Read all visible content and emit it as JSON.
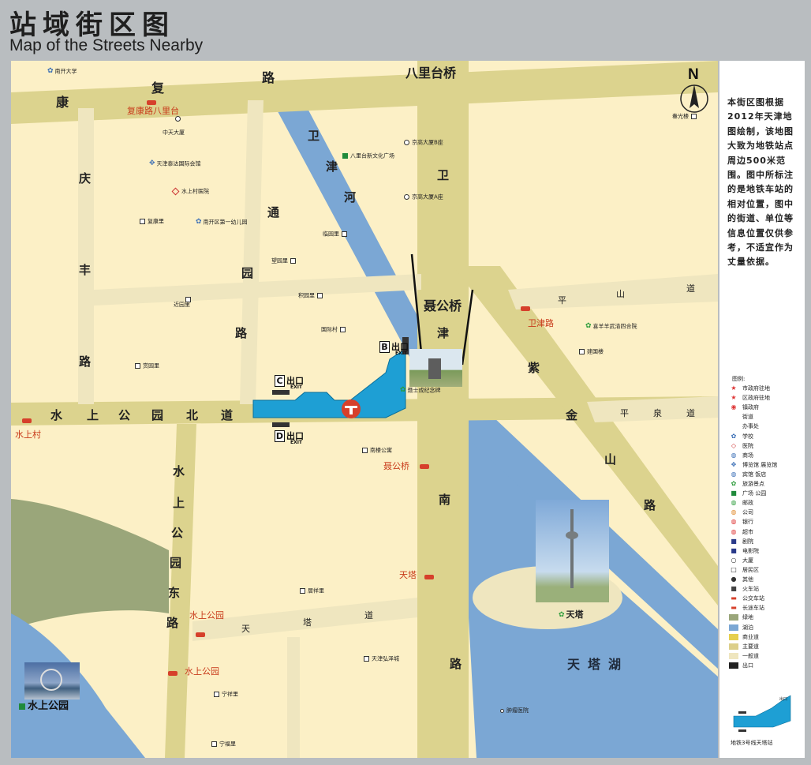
{
  "header": {
    "title_cn": "站域街区图",
    "title_en": "Map of the Streets Nearby"
  },
  "compass": {
    "letter": "N"
  },
  "roads": {
    "fukang_fu": "复",
    "fukang_kang": "康",
    "fukang_lu": "路",
    "balitai_bridge": "八里台桥",
    "qingfeng_qing": "庆",
    "qingfeng_feng": "丰",
    "qingfeng_lu": "路",
    "tongyuan_tong": "通",
    "tongyuan_yuan": "园",
    "tongyuan_lu": "路",
    "weijin_wei": "卫",
    "weijin_jin": "津",
    "niegong_bridge": "聂公桥",
    "shuishang_north": [
      "水",
      "上",
      "公",
      "园",
      "北",
      "道"
    ],
    "shuishang_east": [
      "水",
      "上",
      "公",
      "园",
      "东",
      "路"
    ],
    "weijin_south": [
      "南",
      "路"
    ],
    "pingshan": [
      "平",
      "山",
      "道"
    ],
    "pingquan": [
      "平",
      "泉",
      "道"
    ],
    "zijinshan": [
      "紫",
      "金",
      "山",
      "路"
    ],
    "tianta_dao": [
      "天",
      "塔",
      "道"
    ]
  },
  "water": {
    "weijin_river": [
      "卫",
      "津",
      "河"
    ],
    "tianta_lake": "天塔湖"
  },
  "stops": {
    "fukang_balitai": "复康路八里台",
    "shuishangcun": "水上村",
    "weijinlu": "卫津路",
    "niegongqiao": "聂公桥",
    "tianta": "天塔",
    "shuishang_park_1": "水上公园",
    "shuishang_park_2": "水上公园"
  },
  "pois": {
    "nankai_univ": "南开大学",
    "zhongtian": "中天大厦",
    "taida_hotel": "天津泰达国际会馆",
    "shuishangcun_hospital": "水上村医院",
    "fukang_li": "复康里",
    "kindergarten": "南开区第一幼儿园",
    "balitai_plaza": "八里台新文化广场",
    "jinggao_b": "京高大厦B座",
    "jinggao_a": "京高大厦A座",
    "linyuan": "临园里",
    "wangyuan": "望园里",
    "jinyuan": "近园里",
    "jiyuan": "积园里",
    "guoji": "国际村",
    "shangyuan": "赏园里",
    "chunguang": "春光楼",
    "xiyangyang": "喜羊羊武清四合院",
    "jianguo": "建国楼",
    "nielou": "南楼公寓",
    "niejie_memorial": "聂士成纪念碑",
    "juxiang": "居祥里",
    "hongze": "天津弘泽城",
    "ningxiang": "宁祥里",
    "ningfu": "宁福里",
    "tumor_hospital": "肿瘤医院",
    "tianta_landmark": "天塔",
    "shuishang_park_label": "水上公园"
  },
  "exits": {
    "b": {
      "letter": "B",
      "text": "出口",
      "sub": "EXIT"
    },
    "c": {
      "letter": "C",
      "text": "出口",
      "sub": "EXIT"
    },
    "d": {
      "letter": "D",
      "text": "出口",
      "sub": "EXIT"
    }
  },
  "sidebar": {
    "note": "本街区图根据2012年天津地图绘制，该地图大致为地铁站点周边500米范围。图中所标注的是地铁车站的相对位置，图中的街道、单位等信息位置仅供参考，不适宜作为丈量依据。",
    "legend_title": "图例:",
    "legend": [
      {
        "label": "市政府驻地",
        "sym": "★",
        "color": "#d33"
      },
      {
        "label": "区政府驻地",
        "sym": "★",
        "color": "#d33"
      },
      {
        "label": "镇政府",
        "sym": "◉",
        "color": "#d33"
      },
      {
        "label": "街道",
        "sym": "",
        "color": ""
      },
      {
        "label": "办事处",
        "sym": "",
        "color": ""
      },
      {
        "label": "学校",
        "sym": "✿",
        "color": "#3b6fb6"
      },
      {
        "label": "医院",
        "sym": "◇",
        "color": "#c33"
      },
      {
        "label": "商场",
        "sym": "◍",
        "color": "#3b6fb6"
      },
      {
        "label": "博览馆 展览馆",
        "sym": "✥",
        "color": "#3b6fb6"
      },
      {
        "label": "宾馆 饭店",
        "sym": "◍",
        "color": "#3b6fb6"
      },
      {
        "label": "旅游景点",
        "sym": "✿",
        "color": "#2b9b3a"
      },
      {
        "label": "广场 公园",
        "sym": "■",
        "color": "#1f8a3b"
      },
      {
        "label": "邮政",
        "sym": "◍",
        "color": "#2b9b3a"
      },
      {
        "label": "公司",
        "sym": "◍",
        "color": "#e08a2b"
      },
      {
        "label": "银行",
        "sym": "◍",
        "color": "#d33"
      },
      {
        "label": "超市",
        "sym": "◍",
        "color": "#d33"
      },
      {
        "label": "剧院",
        "sym": "■",
        "color": "#2a3a8a"
      },
      {
        "label": "电影院",
        "sym": "■",
        "color": "#2a3a8a"
      },
      {
        "label": "大厦",
        "sym": "○",
        "color": "#333"
      },
      {
        "label": "居民区",
        "sym": "□",
        "color": "#333"
      },
      {
        "label": "其他",
        "sym": "●",
        "color": "#333"
      },
      {
        "label": "火车站",
        "sym": "■",
        "color": "#444"
      },
      {
        "label": "公交车站",
        "sym": "▬",
        "color": "#d6402b"
      },
      {
        "label": "长途车站",
        "sym": "▬",
        "color": "#d6402b"
      },
      {
        "label": "绿地",
        "swatch": "#9aa67a"
      },
      {
        "label": "湖泊",
        "swatch": "#7ba7d4"
      },
      {
        "label": "商业道",
        "swatch": "#e6cf4f"
      },
      {
        "label": "主要道",
        "swatch": "#dccf8a"
      },
      {
        "label": "一般道",
        "swatch": "#efe6bf"
      },
      {
        "label": "出口",
        "swatch": "#222"
      }
    ],
    "station_name": "地铁3号线天塔站",
    "station_small_label": "出口"
  },
  "colors": {
    "block": "#fcf0c6",
    "road": "#dcd38e",
    "water": "#7ba7d4",
    "green": "#9aa67a",
    "station": "#1e9fd4"
  }
}
